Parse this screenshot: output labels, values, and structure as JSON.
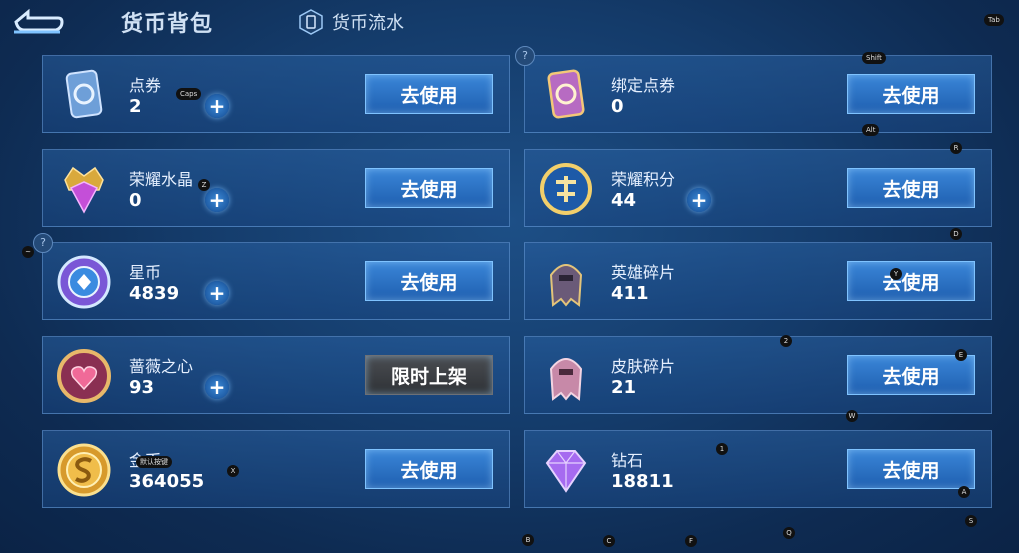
{
  "header": {
    "title": "货币背包",
    "flow_label": "货币流水"
  },
  "currencies": [
    {
      "name": "点券",
      "value": "2",
      "button": "去使用"
    },
    {
      "name": "绑定点券",
      "value": "0",
      "button": "去使用"
    },
    {
      "name": "荣耀水晶",
      "value": "0",
      "button": "去使用"
    },
    {
      "name": "荣耀积分",
      "value": "44",
      "button": "去使用"
    },
    {
      "name": "星币",
      "value": "4839",
      "button": "去使用"
    },
    {
      "name": "英雄碎片",
      "value": "411",
      "button": "去使用"
    },
    {
      "name": "蔷薇之心",
      "value": "93",
      "button": "限时上架"
    },
    {
      "name": "皮肤碎片",
      "value": "21",
      "button": "去使用"
    },
    {
      "name": "金币",
      "value": "364055",
      "button": "去使用"
    },
    {
      "name": "钻石",
      "value": "18811",
      "button": "去使用"
    }
  ],
  "labels": {
    "plus": "+",
    "help": "?"
  },
  "hotkeys": [
    "Tab",
    "Caps",
    "Shift",
    "Alt",
    "R",
    "Z",
    "D",
    "~",
    "Y",
    "2",
    "E",
    "W",
    "1",
    "X",
    "A",
    "S",
    "B",
    "C",
    "F",
    "Q",
    "默认按键"
  ],
  "icons": [
    "back-arrow-icon",
    "coupon-card-icon",
    "bound-coupon-icon",
    "crystal-icon",
    "points-icon",
    "star-coin-icon",
    "hero-shard-icon",
    "rose-heart-icon",
    "skin-shard-icon",
    "gold-coin-icon",
    "diamond-icon"
  ],
  "colors": {
    "button_blue": "#2f76c8",
    "button_disabled": "#3f4246",
    "panel_border": "#5b8cc8"
  }
}
